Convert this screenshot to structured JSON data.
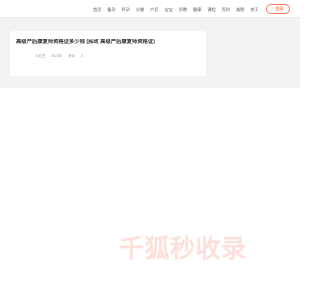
{
  "nav": {
    "items": [
      "首页",
      "备孕",
      "怀孕",
      "分娩",
      "产后",
      "宝宝",
      "早教",
      "健康",
      "课程",
      "百科",
      "减肥",
      "关于"
    ],
    "login_label": "↑ 登录"
  },
  "article": {
    "title": "高级产后康复师资格证多少钱 (民政 高级产后康复师资格证)",
    "meta": [
      "小红豆",
      "2023年",
      "育评",
      "0"
    ]
  },
  "footer": {
    "logo_text": "千狐秒收录"
  },
  "colors": {
    "accent": "#ff5a36",
    "logo": "#fde0d9",
    "content_bg": "#f3f3f3"
  }
}
